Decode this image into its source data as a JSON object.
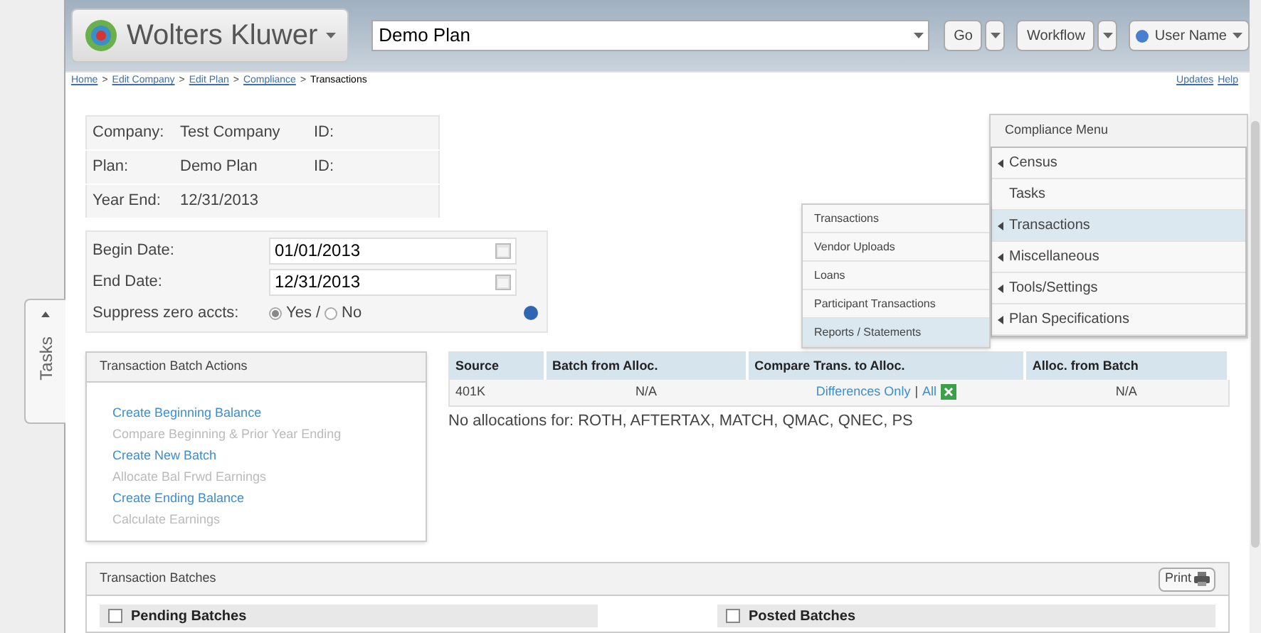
{
  "header": {
    "logo_text": "Wolters Kluwer",
    "search": {
      "value": "Demo Plan"
    },
    "go": "Go",
    "workflow": "Workflow",
    "user": "User Name"
  },
  "breadcrumb": {
    "links": [
      "Home",
      "Edit Company",
      "Edit Plan",
      "Compliance"
    ],
    "separator": ">",
    "current": "Transactions"
  },
  "top_links": [
    "Updates",
    "Help"
  ],
  "side_tab": "Tasks",
  "plan_info": [
    {
      "label": "Company:",
      "value": "Test Company",
      "id_label": "ID:"
    },
    {
      "label": "Plan:",
      "value": "Demo Plan",
      "id_label": "ID:"
    },
    {
      "label": "Year End:",
      "value": "12/31/2013"
    }
  ],
  "dates": [
    {
      "label": "Begin Date:",
      "value": "01/01/2013"
    },
    {
      "label": "End Date:",
      "value": "12/31/2013"
    }
  ],
  "suppress": {
    "label": "Suppress zero accts:",
    "separator": "/",
    "options": [
      {
        "label": "Yes",
        "selected": true
      },
      {
        "label": "No",
        "selected": false
      }
    ]
  },
  "compliance_menu": {
    "title": "Compliance Menu",
    "items": [
      {
        "label": "Census",
        "has_submenu": true,
        "selected": false
      },
      {
        "label": "Tasks",
        "has_submenu": false,
        "selected": false
      },
      {
        "label": "Transactions",
        "has_submenu": true,
        "selected": true
      },
      {
        "label": "Miscellaneous",
        "has_submenu": true,
        "selected": false
      },
      {
        "label": "Tools/Settings",
        "has_submenu": true,
        "selected": false
      },
      {
        "label": "Plan Specifications",
        "has_submenu": true,
        "selected": false
      }
    ]
  },
  "submenu": [
    {
      "label": "Transactions",
      "selected": false
    },
    {
      "label": "Vendor Uploads",
      "selected": false
    },
    {
      "label": "Loans",
      "selected": false
    },
    {
      "label": "Participant Transactions",
      "selected": false
    },
    {
      "label": "Reports / Statements",
      "selected": true
    }
  ],
  "batch_actions": {
    "title": "Transaction Batch Actions",
    "items": [
      {
        "label": "Create Beginning Balance",
        "disabled": false
      },
      {
        "label": "Compare Beginning & Prior Year Ending",
        "disabled": true
      },
      {
        "label": "Create New Batch",
        "disabled": false
      },
      {
        "label": "Allocate Bal Frwd Earnings",
        "disabled": true
      },
      {
        "label": "Create Ending Balance",
        "disabled": false
      },
      {
        "label": "Calculate Earnings",
        "disabled": true
      }
    ]
  },
  "source_table": {
    "columns": [
      "Source",
      "Batch from Alloc.",
      "Compare Trans. to Alloc.",
      "Alloc. from Batch"
    ],
    "rows": [
      {
        "source": "401K",
        "batch_from_alloc": "N/A",
        "compare_links": [
          "Differences Only",
          "All"
        ],
        "compare_separator": "|",
        "alloc_from_batch": "N/A"
      }
    ]
  },
  "note": "No allocations for: ROTH, AFTERTAX, MATCH, QMAC, QNEC, PS",
  "batches": {
    "title": "Transaction Batches",
    "print": "Print",
    "panels": [
      {
        "label": "Pending Batches",
        "checked": false
      },
      {
        "label": "Posted Batches",
        "checked": false
      }
    ]
  }
}
